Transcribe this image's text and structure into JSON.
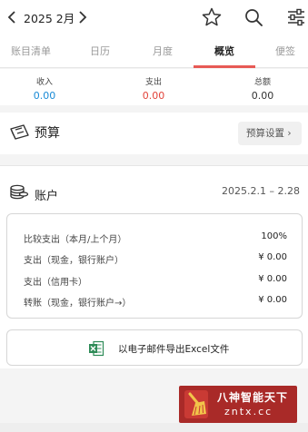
{
  "header": {
    "month": "2025 2月",
    "icons": [
      "chevron-left-icon",
      "chevron-right-icon",
      "star-icon",
      "search-icon",
      "sliders-icon"
    ]
  },
  "tabs": [
    {
      "label": "账目清单",
      "active": false
    },
    {
      "label": "日历",
      "active": false
    },
    {
      "label": "月度",
      "active": false
    },
    {
      "label": "概览",
      "active": true
    },
    {
      "label": "便签",
      "active": false
    }
  ],
  "summary": {
    "income": {
      "label": "收入",
      "value": "0.00",
      "color": "#1a8bd6"
    },
    "expense": {
      "label": "支出",
      "value": "0.00",
      "color": "#e2433a"
    },
    "balance": {
      "label": "总额",
      "value": "0.00",
      "color": "#333333"
    }
  },
  "budget": {
    "title": "预算",
    "settings_label": "预算设置 ›"
  },
  "account": {
    "title": "账户",
    "date_range": "2025.2.1 – 2.28",
    "rows": [
      {
        "label": "比较支出（本月/上个月）",
        "value": "100%"
      },
      {
        "label": "支出（现金，银行账户）",
        "value": "¥ 0.00"
      },
      {
        "label": "支出（信用卡）",
        "value": "¥ 0.00"
      },
      {
        "label": "转账（现金，银行账户→）",
        "value": "¥ 0.00"
      }
    ],
    "export_label": "以电子邮件导出Excel文件"
  },
  "watermark": {
    "line1": "八神智能天下",
    "line2": "zntx.cc"
  },
  "colors": {
    "accent": "#e75a55",
    "income": "#1a8bd6",
    "expense": "#e2433a",
    "watermark_bg": "#a92a28"
  }
}
